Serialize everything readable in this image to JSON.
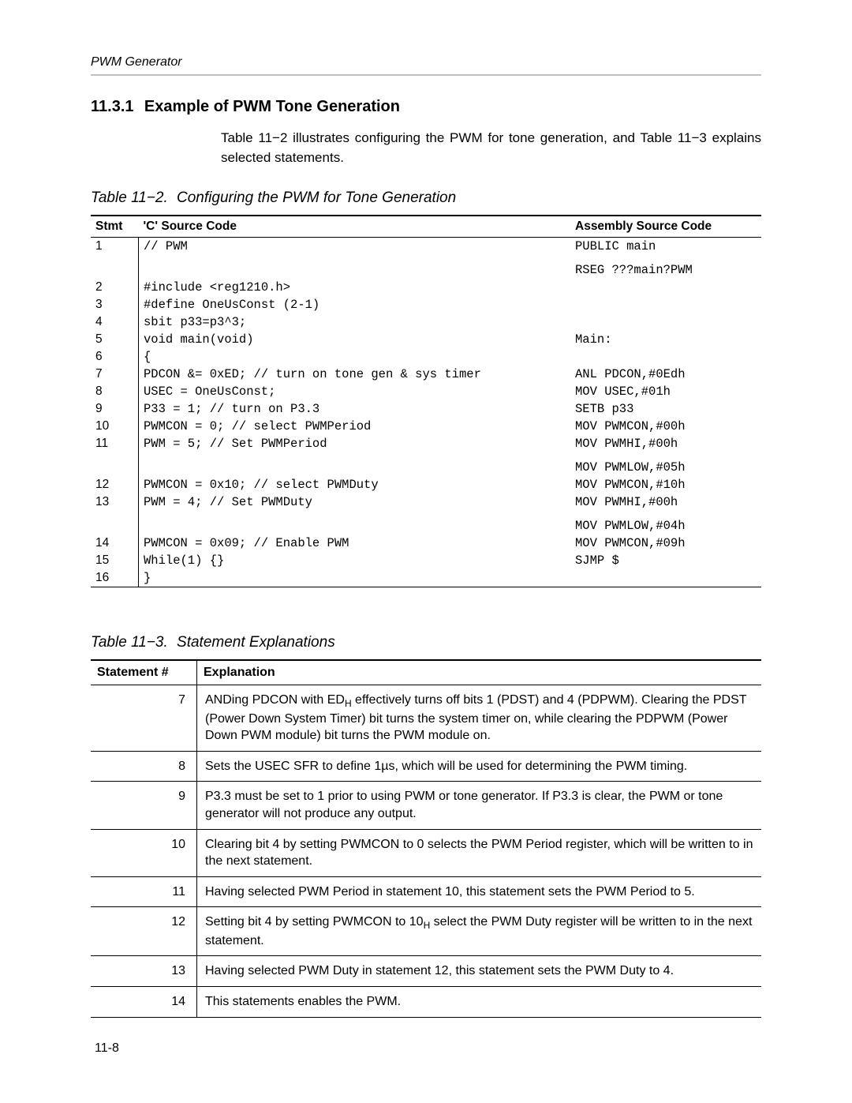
{
  "running_head": "PWM Generator",
  "section": {
    "number": "11.3.1",
    "title": "Example of PWM Tone Generation"
  },
  "intro": "Table 11−2 illustrates configuring the PWM for tone generation, and Table 11−3 explains selected statements.",
  "code_table": {
    "caption_num": "Table 11−2.",
    "caption_title": "Configuring the PWM for Tone Generation",
    "headers": {
      "stmt": "Stmt",
      "c": "'C' Source Code",
      "asm": "Assembly Source Code"
    },
    "rows": [
      {
        "stmt": "1",
        "c": "// PWM",
        "asm": "PUBLIC main"
      },
      {
        "stmt": "",
        "c": "",
        "asm": "RSEG ???main?PWM"
      },
      {
        "stmt": "2",
        "c": "#include <reg1210.h>",
        "asm": ""
      },
      {
        "stmt": "3",
        "c": "#define OneUsConst (2-1)",
        "asm": ""
      },
      {
        "stmt": "4",
        "c": "sbit p33=p3^3;",
        "asm": ""
      },
      {
        "stmt": "5",
        "c": "void main(void)",
        "asm": "Main:"
      },
      {
        "stmt": "6",
        "c": "{",
        "asm": ""
      },
      {
        "stmt": "7",
        "c": "PDCON &= 0xED; // turn on tone gen & sys timer",
        "asm": "ANL PDCON,#0Edh"
      },
      {
        "stmt": "8",
        "c": "USEC = OneUsConst;",
        "asm": "MOV USEC,#01h"
      },
      {
        "stmt": "9",
        "c": "P33 = 1; // turn on P3.3",
        "asm": "SETB p33"
      },
      {
        "stmt": "10",
        "c": "PWMCON = 0; // select PWMPeriod",
        "asm": "MOV PWMCON,#00h"
      },
      {
        "stmt": "11",
        "c": "PWM = 5; // Set PWMPeriod",
        "asm": "MOV PWMHI,#00h"
      },
      {
        "stmt": "",
        "c": "",
        "asm": "MOV PWMLOW,#05h"
      },
      {
        "stmt": "12",
        "c": "PWMCON = 0x10; // select PWMDuty",
        "asm": "MOV PWMCON,#10h"
      },
      {
        "stmt": "13",
        "c": "PWM = 4; // Set PWMDuty",
        "asm": "MOV PWMHI,#00h"
      },
      {
        "stmt": "",
        "c": "",
        "asm": "MOV PWMLOW,#04h"
      },
      {
        "stmt": "14",
        "c": "PWMCON = 0x09; // Enable PWM",
        "asm": "MOV PWMCON,#09h"
      },
      {
        "stmt": "15",
        "c": "While(1) {}",
        "asm": "SJMP $"
      },
      {
        "stmt": "16",
        "c": "}",
        "asm": ""
      }
    ]
  },
  "exp_table": {
    "caption_num": "Table 11−3.",
    "caption_title": "Statement Explanations",
    "headers": {
      "num": "Statement #",
      "exp": "Explanation"
    },
    "rows": [
      {
        "num": "7",
        "exp_html": "ANDing PDCON with ED<span class='sub'>H</span> effectively turns off bits 1 (PDST) and 4 (PDPWM). Clearing the PDST (Power Down System Timer) bit turns the system timer on, while clearing the PDPWM (Power Down PWM module) bit turns the PWM module on."
      },
      {
        "num": "8",
        "exp_html": "Sets the USEC SFR to define 1µs, which will be used for determining the PWM timing."
      },
      {
        "num": "9",
        "exp_html": "P3.3 must be set to 1 prior to using PWM or tone generator. If P3.3 is clear, the PWM or tone generator will not produce any output."
      },
      {
        "num": "10",
        "exp_html": "Clearing bit 4 by setting PWMCON to 0 selects the PWM Period register, which will be written to in the next statement."
      },
      {
        "num": "11",
        "exp_html": "Having selected PWM Period in statement 10, this statement sets the PWM Period to 5."
      },
      {
        "num": "12",
        "exp_html": "Setting bit 4 by setting PWMCON to 10<span class='sub'>H</span> select the PWM Duty register will be written to in the next statement."
      },
      {
        "num": "13",
        "exp_html": "Having selected PWM Duty in statement 12, this statement sets the PWM Duty to 4."
      },
      {
        "num": "14",
        "exp_html": "This statements enables the PWM."
      }
    ]
  },
  "page_number": "11-8"
}
